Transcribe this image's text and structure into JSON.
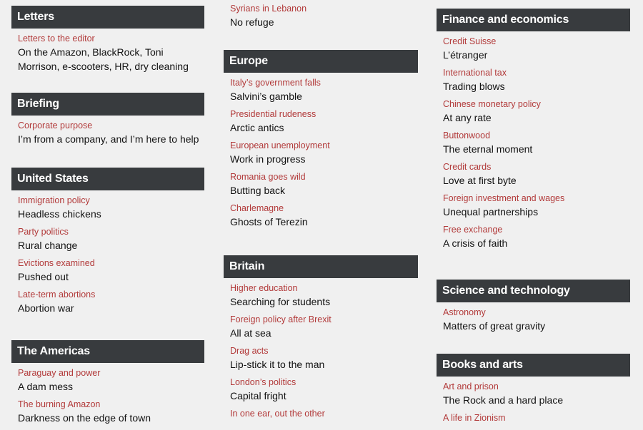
{
  "colors": {
    "background": "#f0f0f0",
    "section_header_bg": "#383b3e",
    "section_header_text": "#ffffff",
    "kicker": "#b23a3a",
    "headline": "#121212"
  },
  "columns": [
    {
      "sections": [
        {
          "title": "Letters",
          "items": [
            {
              "kicker": "Letters to the editor",
              "headline": "On the Amazon, BlackRock, Toni Morrison, e-scooters, HR, dry cleaning"
            }
          ]
        },
        {
          "title": "Briefing",
          "items": [
            {
              "kicker": "Corporate purpose",
              "headline": "I’m from a company, and I’m here to help"
            }
          ]
        },
        {
          "title": "United States",
          "items": [
            {
              "kicker": "Immigration policy",
              "headline": "Headless chickens"
            },
            {
              "kicker": "Party politics",
              "headline": "Rural change"
            },
            {
              "kicker": "Evictions examined",
              "headline": "Pushed out"
            },
            {
              "kicker": "Late-term abortions",
              "headline": "Abortion war"
            }
          ]
        },
        {
          "title": "The Americas",
          "items": [
            {
              "kicker": "Paraguay and power",
              "headline": "A dam mess"
            },
            {
              "kicker": "The burning Amazon",
              "headline": "Darkness on the edge of town"
            }
          ]
        }
      ]
    },
    {
      "continued": {
        "kicker": "Syrians in Lebanon",
        "headline": "No refuge"
      },
      "sections": [
        {
          "title": "Europe",
          "items": [
            {
              "kicker": "Italy’s government falls",
              "headline": "Salvini’s gamble"
            },
            {
              "kicker": "Presidential rudeness",
              "headline": "Arctic antics"
            },
            {
              "kicker": "European unemployment",
              "headline": "Work in progress"
            },
            {
              "kicker": "Romania goes wild",
              "headline": "Butting back"
            },
            {
              "kicker": "Charlemagne",
              "headline": "Ghosts of Terezin"
            }
          ]
        },
        {
          "title": "Britain",
          "items": [
            {
              "kicker": "Higher education",
              "headline": "Searching for students"
            },
            {
              "kicker": "Foreign policy after Brexit",
              "headline": "All at sea"
            },
            {
              "kicker": "Drag acts",
              "headline": "Lip-stick it to the man"
            },
            {
              "kicker": "London’s politics",
              "headline": "Capital fright"
            },
            {
              "kicker": "In one ear, out the other",
              "headline": ""
            }
          ]
        }
      ]
    },
    {
      "sections": [
        {
          "title": "Finance and economics",
          "items": [
            {
              "kicker": "Credit Suisse",
              "headline": "L’étranger"
            },
            {
              "kicker": "International tax",
              "headline": "Trading blows"
            },
            {
              "kicker": "Chinese monetary policy",
              "headline": "At any rate"
            },
            {
              "kicker": "Buttonwood",
              "headline": "The eternal moment"
            },
            {
              "kicker": "Credit cards",
              "headline": "Love at first byte"
            },
            {
              "kicker": "Foreign investment and wages",
              "headline": "Unequal partnerships"
            },
            {
              "kicker": "Free exchange",
              "headline": "A crisis of faith"
            }
          ]
        },
        {
          "title": "Science and technology",
          "items": [
            {
              "kicker": "Astronomy",
              "headline": "Matters of great gravity"
            }
          ]
        },
        {
          "title": "Books and arts",
          "items": [
            {
              "kicker": "Art and prison",
              "headline": "The Rock and a hard place"
            },
            {
              "kicker": "A life in Zionism",
              "headline": ""
            }
          ]
        }
      ]
    }
  ]
}
